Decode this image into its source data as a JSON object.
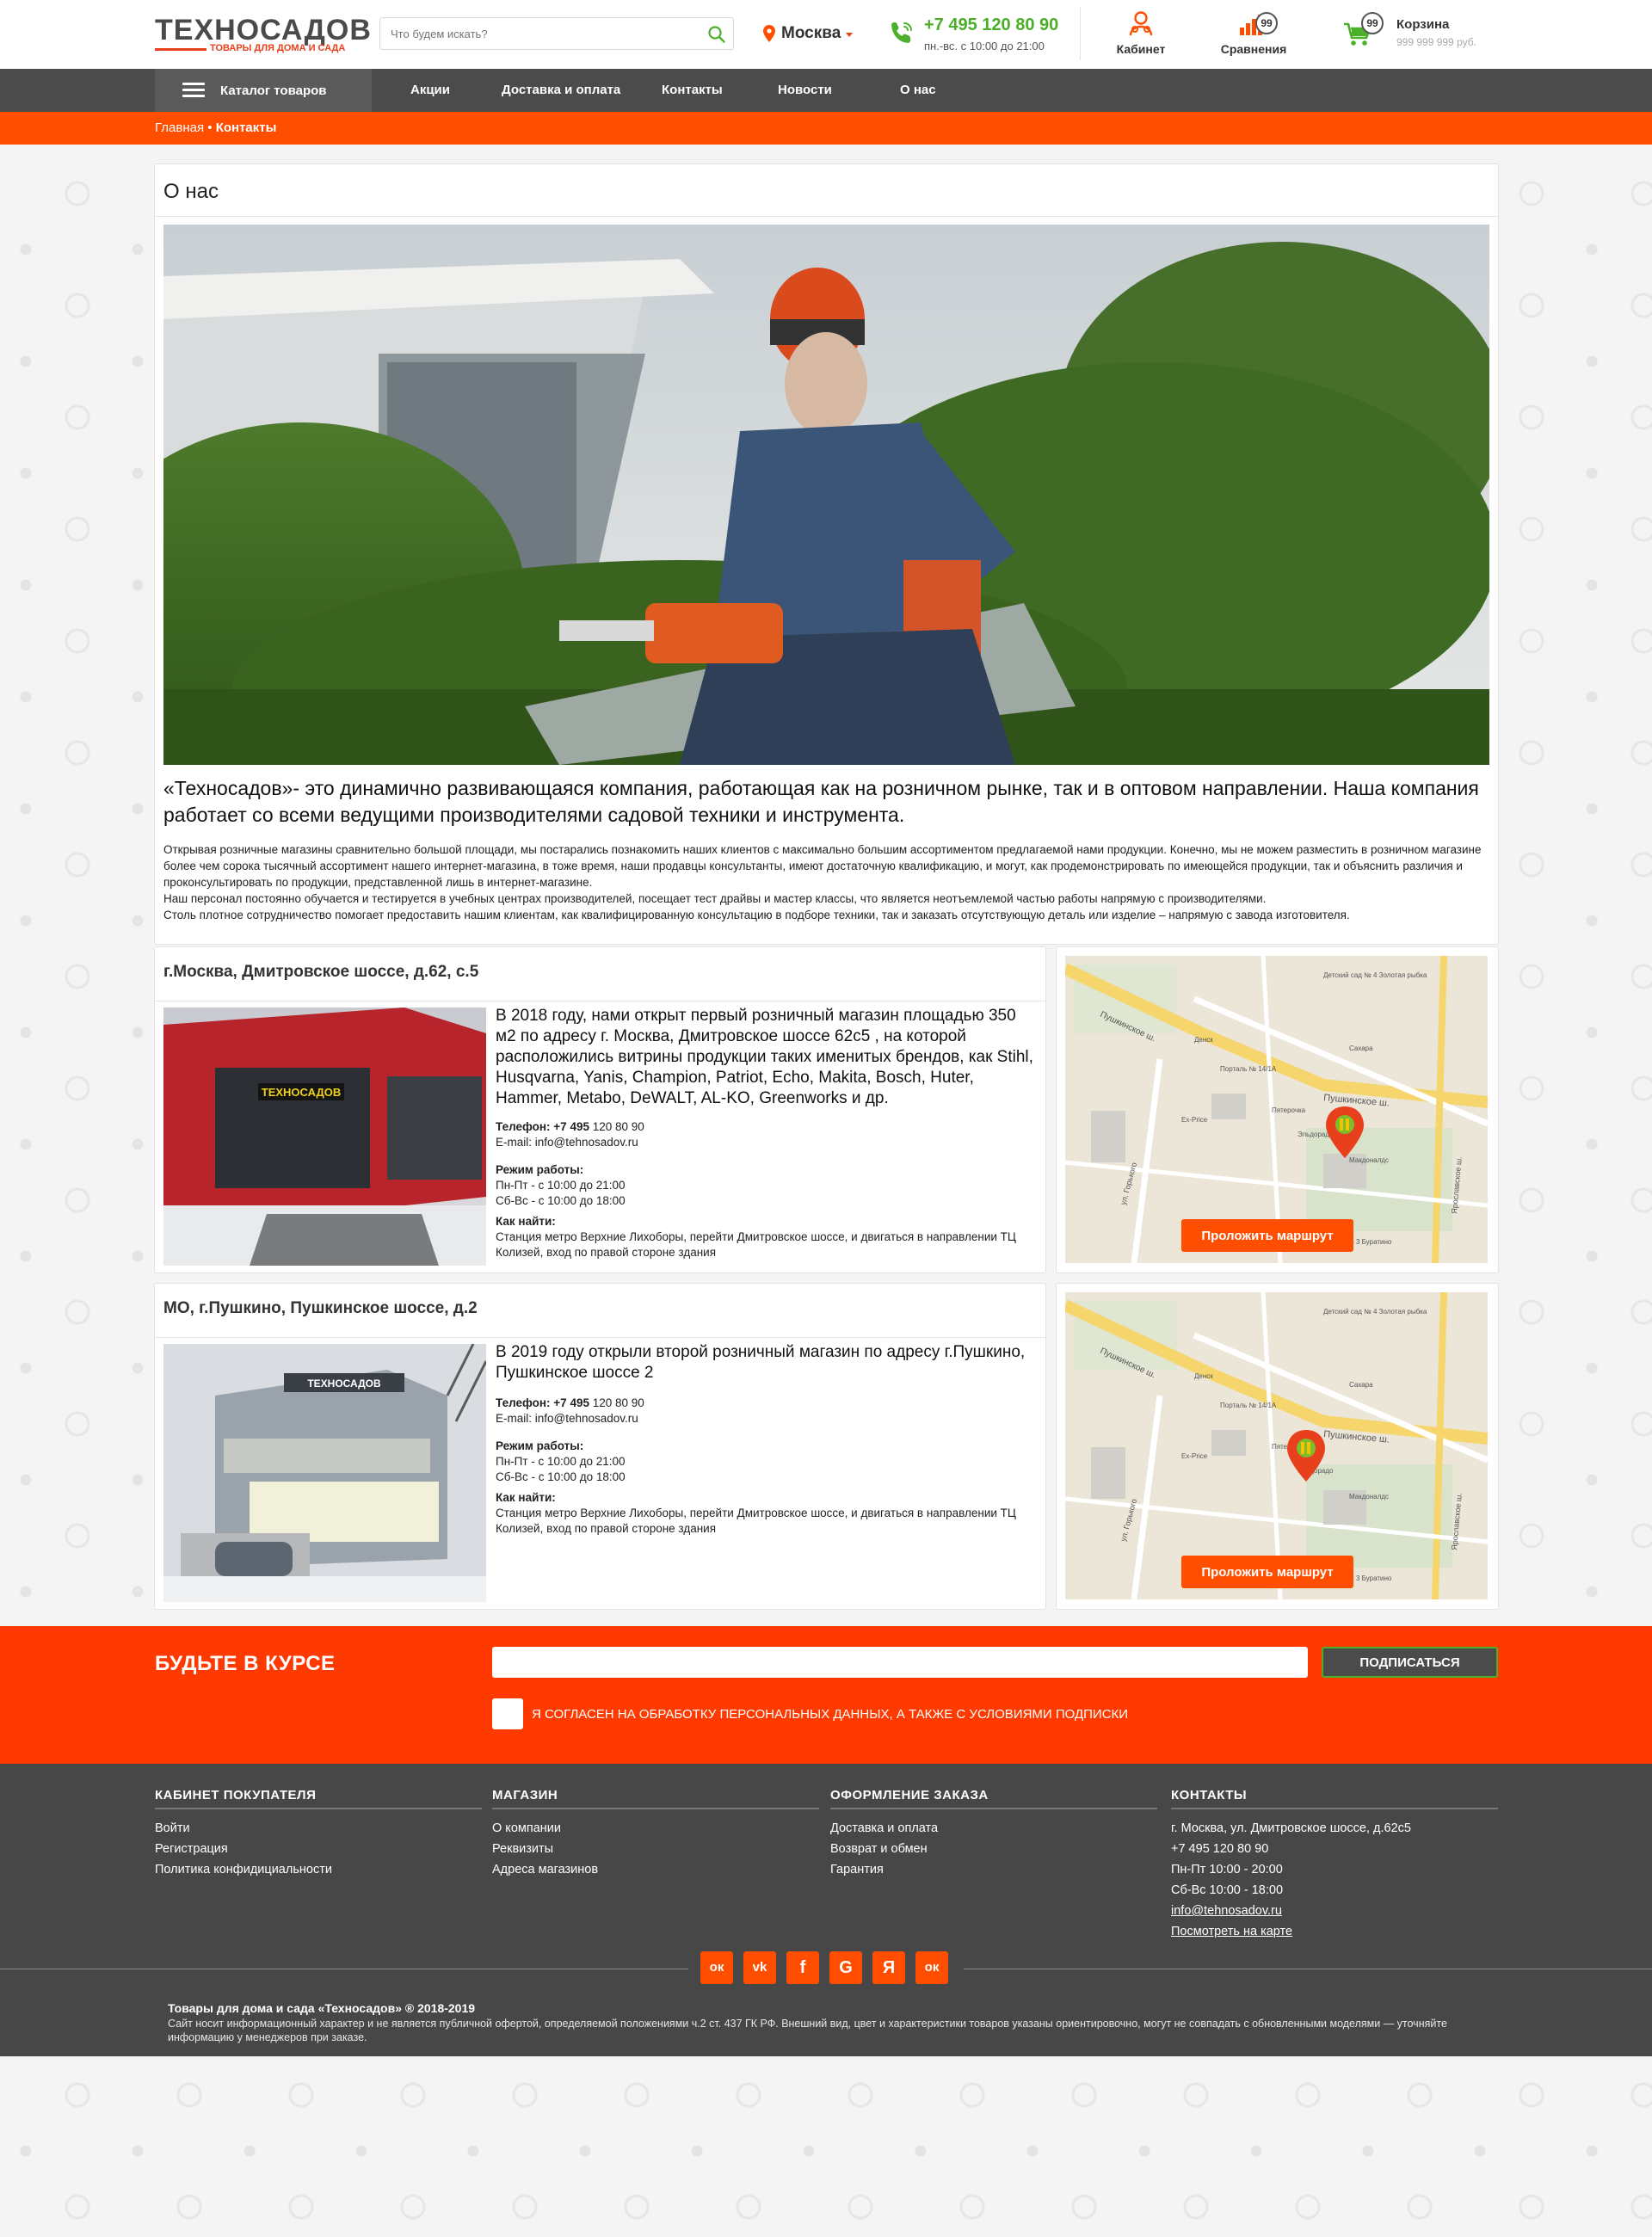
{
  "header": {
    "logo_title": "ТЕХНОСАДОВ",
    "logo_subtitle": "ТОВАРЫ ДЛЯ ДОМА И САДА",
    "search_placeholder": "Что будем искать?",
    "city": "Москва",
    "phone": "+7 495 120 80 90",
    "phone_hours": "пн.-вс. с 10:00 до 21:00",
    "cabinet_label": "Кабинет",
    "compare_label": "Сравнения",
    "compare_count": "99",
    "cart_label": "Корзина",
    "cart_count": "99",
    "cart_sum": "999 999 999 руб."
  },
  "nav": {
    "catalog": "Каталог товаров",
    "items": [
      "Акции",
      "Доставка и оплата",
      "Контакты",
      "Новости",
      "О нас"
    ]
  },
  "breadcrumb": {
    "home": "Главная",
    "separator": "•",
    "current": "Контакты"
  },
  "about": {
    "title": "О нас",
    "intro": "«Техносадов»- это динамично развивающаяся компания, работающая как на розничном рынке, так и в оптовом направлении. Наша компания работает со всеми ведущими производителями садовой техники и инструмента.",
    "paragraph1": "Открывая розничные магазины сравнительно большой площади, мы постарались познакомить наших клиентов с максимально большим ассортиментом предлагаемой нами продукции. Конечно, мы не можем разместить в розничном магазине более чем сорока тысячный ассортимент нашего интернет-магазина, в тоже время, наши продавцы консультанты, имеют достаточную квалификацию, и могут, как продемонстрировать по имеющейся продукции, так и объяснить различия и проконсультировать по продукции, представленной лишь в интернет-магазине.",
    "paragraph2": "Наш персонал постоянно обучается и тестируется в учебных центрах производителей, посещает тест драйвы и мастер классы, что является неотъемлемой частью работы напрямую с производителями.",
    "paragraph3": "Столь плотное сотрудничество помогает предоставить нашим клиентам, как квалифицированную консультацию в подборе техники, так и заказать отсутствующую деталь или изделие – напрямую с завода изготовителя."
  },
  "stores": [
    {
      "title": "г.Москва, Дмитровское шоссе, д.62, с.5",
      "description": "В 2018 году, нами открыт первый розничный магазин площадью 350 м2 по адресу г. Москва, Дмитровское шоссе 62с5 , на которой расположились витрины продукции таких именитых брендов, как Stihl, Husqvarna, Yanis, Champion, Patriot, Echo, Makita, Bosch, Huter, Hammer, Metabo, DeWALT, AL-KO, Greenworks и др.",
      "phone_label": "Телефон:",
      "phone_code": "+7 495",
      "phone_rest": "120 80 90",
      "email": "E-mail: info@tehnosadov.ru",
      "hours_label": "Режим работы:",
      "hours_weekdays": "Пн-Пт - с 10:00 до 21:00",
      "hours_weekend": "Сб-Вс - с 10:00 до 18:00",
      "find_label": "Как найти:",
      "find_text": "Станция метро Верхние Лихоборы, перейти Дмитровское шоссе, и двигаться в направлении ТЦ Колизей, вход по правой стороне здания",
      "sign": "ТЕХНОСАДОВ",
      "route_button": "Проложить маршрут"
    },
    {
      "title": "МО, г.Пушкино, Пушкинское шоссе, д.2",
      "description": "В 2019 году открыли второй розничный магазин по адресу г.Пушкино, Пушкинское шоссе 2",
      "phone_label": "Телефон:",
      "phone_code": "+7 495",
      "phone_rest": "120 80 90",
      "email": "E-mail: info@tehnosadov.ru",
      "hours_label": "Режим работы:",
      "hours_weekdays": "Пн-Пт - с 10:00 до 21:00",
      "hours_weekend": "Сб-Вс - с 10:00 до 18:00",
      "find_label": "Как найти:",
      "find_text": "Станция метро Верхние Лихоборы, перейти Дмитровское шоссе, и двигаться в направлении ТЦ Колизей, вход по правой стороне здания",
      "sign": "ТЕХНОСАДОВ",
      "route_button": "Проложить маршрут"
    }
  ],
  "map_labels": {
    "street1": "Пушкинское ш.",
    "street2": "Пушкинское ш.",
    "poi1": "Детский сад № 4 Золотая рыбка",
    "poi2": "Сахара",
    "poi3": "Пятерочка",
    "poi4": "Эльдорадо",
    "poi5": "Макдоналдс",
    "poi6": "Ex-Price",
    "poi7": "Детский сад № 3 Буратино",
    "poi8": "Денск",
    "poi9": "Порталь № 14/1А",
    "street3": "ул. Горького",
    "street4": "Ярославское ш."
  },
  "subscribe": {
    "title": "БУДЬТЕ В КУРСЕ",
    "button": "ПОДПИСАТЬСЯ",
    "consent": "Я СОГЛАСЕН НА ОБРАБОТКУ ПЕРСОНАЛЬНЫХ ДАННЫХ, А ТАКЖЕ С УСЛОВИЯМИ ПОДПИСКИ"
  },
  "footer": {
    "col1": {
      "title": "КАБИНЕТ ПОКУПАТЕЛЯ",
      "links": [
        "Войти",
        "Регистрация",
        "Политика конфидициальности"
      ]
    },
    "col2": {
      "title": "МАГАЗИН",
      "links": [
        "О компании",
        "Реквизиты",
        "Адреса магазинов"
      ]
    },
    "col3": {
      "title": "ОФОРМЛЕНИЕ ЗАКАЗА",
      "links": [
        "Доставка и оплата",
        "Возврат и обмен",
        "Гарантия"
      ]
    },
    "col4": {
      "title": "КОНТАКТЫ",
      "lines": [
        "г. Москва, ул. Дмитровское шоссе, д.62с5",
        "+7 495 120 80 90",
        "Пн-Пт 10:00 - 20:00",
        "Сб-Вс 10:00 - 18:00",
        "info@tehnosadov.ru",
        "Посмотреть на карте"
      ]
    },
    "social": [
      "odnoklassniki-alt-icon",
      "vk-icon",
      "facebook-icon",
      "google-icon",
      "yandex-icon",
      "odnoklassniki-icon"
    ],
    "social_glyphs": [
      "ок",
      "vk",
      "f",
      "G",
      "Я",
      "ок"
    ],
    "copyright_title": "Товары для дома и сада «Техносадов» ® 2018-2019",
    "copyright_text": "Сайт носит информационный характер и не является публичной офертой, определяемой положениями ч.2 ст. 437 ГК РФ. Внешний вид, цвет и характеристики товаров указаны ориентировочно, могут не совпадать с обновленными моделями — уточняйте информацию у менеджеров при заказе."
  },
  "colors": {
    "accent": "#ff4e00",
    "green": "#4caf2a",
    "dark": "#474747",
    "nav": "#4b4b4b"
  }
}
